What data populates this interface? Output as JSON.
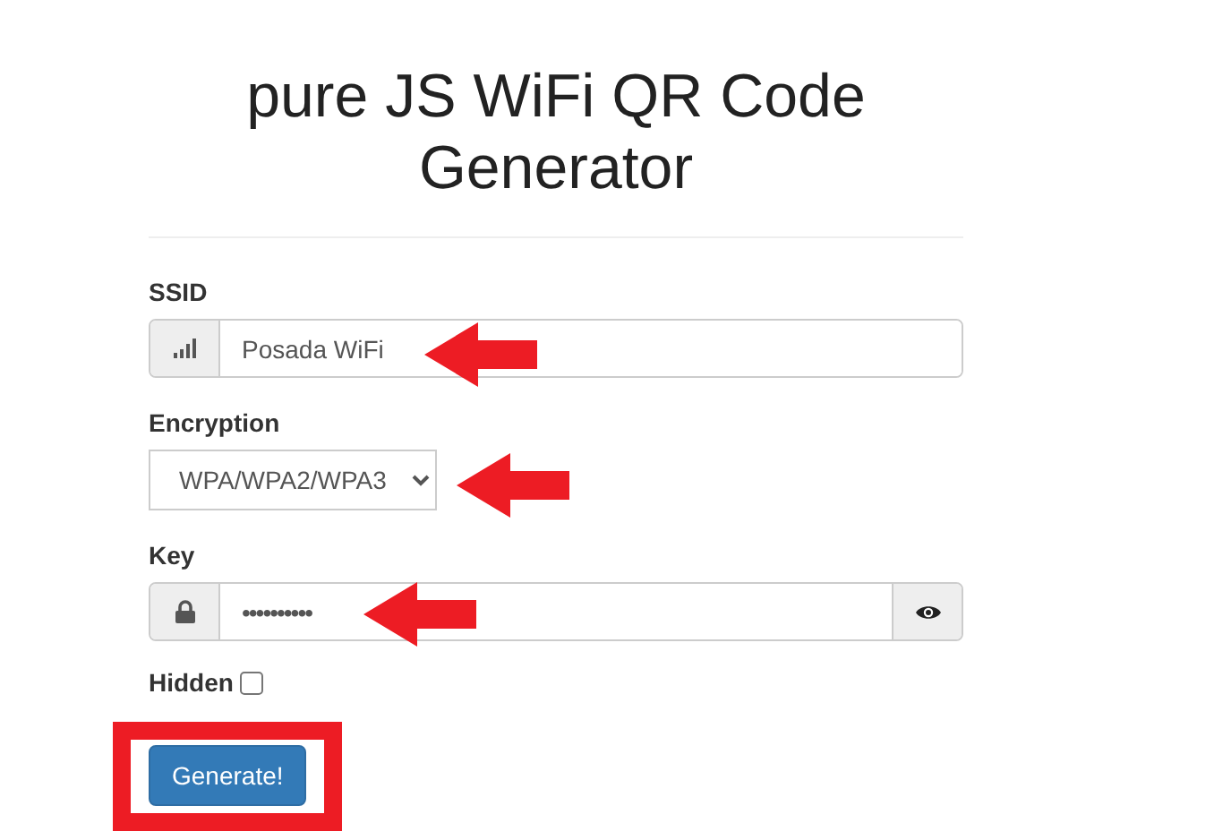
{
  "title": "pure JS WiFi QR Code Generator",
  "fields": [
    {
      "kind": "text",
      "label": "SSID",
      "value": "Posada WiFi",
      "arrowed": true
    },
    {
      "kind": "select",
      "label": "Encryption",
      "value": "WPA/WPA2/WPA3",
      "arrowed": true
    },
    {
      "kind": "password",
      "label": "Key",
      "value": "••••••••••",
      "arrowed": true
    }
  ],
  "hidden": {
    "label": "Hidden",
    "checked": false
  },
  "button": {
    "label": "Generate!",
    "highlighted": true
  }
}
